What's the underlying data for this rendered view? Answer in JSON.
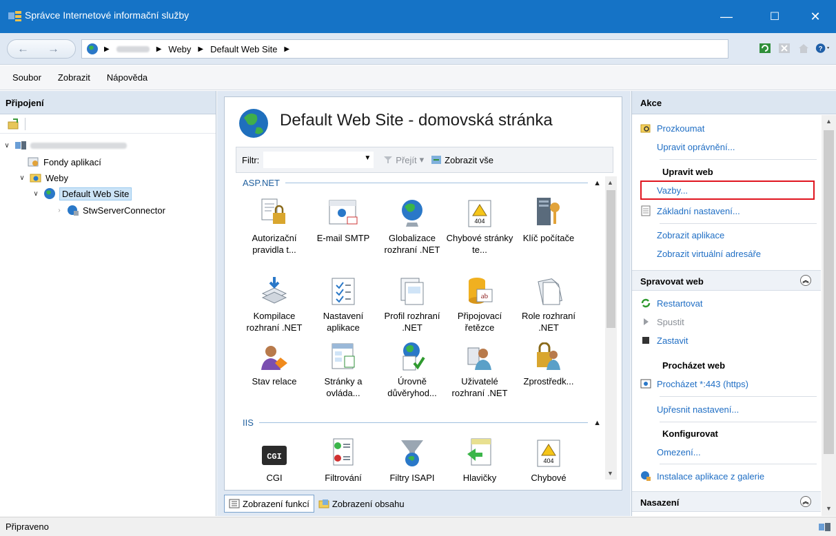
{
  "window": {
    "title": "Správce Internetové informační služby",
    "minimize": "—",
    "maximize": "☐",
    "close": "✕"
  },
  "address": {
    "crumbs": [
      "Weby",
      "Default Web Site"
    ],
    "icons": [
      "refresh-icon",
      "stop-icon",
      "home-icon",
      "help-icon"
    ]
  },
  "menu": {
    "file": "Soubor",
    "view": "Zobrazit",
    "help": "Nápověda"
  },
  "connections": {
    "title": "Připojení",
    "tree": {
      "app_pools": "Fondy aplikací",
      "sites": "Weby",
      "default_site": "Default Web Site",
      "connector": "StwServerConnector"
    }
  },
  "main": {
    "title": "Default Web Site - domovská stránka",
    "filter_label": "Filtr:",
    "go_label": "Přejít",
    "show_all_label": "Zobrazit vše",
    "group_aspnet": "ASP.NET",
    "group_iis": "IIS",
    "features": [
      "Autorizační pravidla t...",
      "E-mail SMTP",
      "Globalizace rozhraní .NET",
      "Chybové stránky te...",
      "Klíč počítače",
      "Kompilace rozhraní .NET",
      "Nastavení aplikace",
      "Profil rozhraní .NET",
      "Připojovací řetězce",
      "Role rozhraní .NET",
      "Stav relace",
      "Stránky a ovláda...",
      "Úrovně důvěryhod...",
      "Uživatelé rozhraní .NET",
      "Zprostředk..."
    ],
    "iis_features": [
      "CGI",
      "Filtrování",
      "Filtry ISAPI",
      "Hlavičky",
      "Chybové"
    ],
    "tab_features": "Zobrazení funkcí",
    "tab_content": "Zobrazení obsahu"
  },
  "actions": {
    "title": "Akce",
    "explore": "Prozkoumat",
    "edit_permissions": "Upravit oprávnění...",
    "edit_site": "Upravit web",
    "bindings": "Vazby...",
    "basic_settings": "Základní nastavení...",
    "view_apps": "Zobrazit aplikace",
    "view_vdirs": "Zobrazit virtuální adresáře",
    "manage_site": "Spravovat web",
    "restart": "Restartovat",
    "start": "Spustit",
    "stop": "Zastavit",
    "browse_site": "Procházet web",
    "browse_443": "Procházet *:443 (https)",
    "advanced_settings": "Upřesnit nastavení...",
    "configure": "Konfigurovat",
    "limits": "Omezení...",
    "install_gallery": "Instalace aplikace z galerie",
    "deployment": "Nasazení"
  },
  "status": {
    "text": "Připraveno"
  },
  "colors": {
    "titlebar": "#1573c6",
    "link": "#1f6ec4",
    "highlight": "#e0141e"
  }
}
